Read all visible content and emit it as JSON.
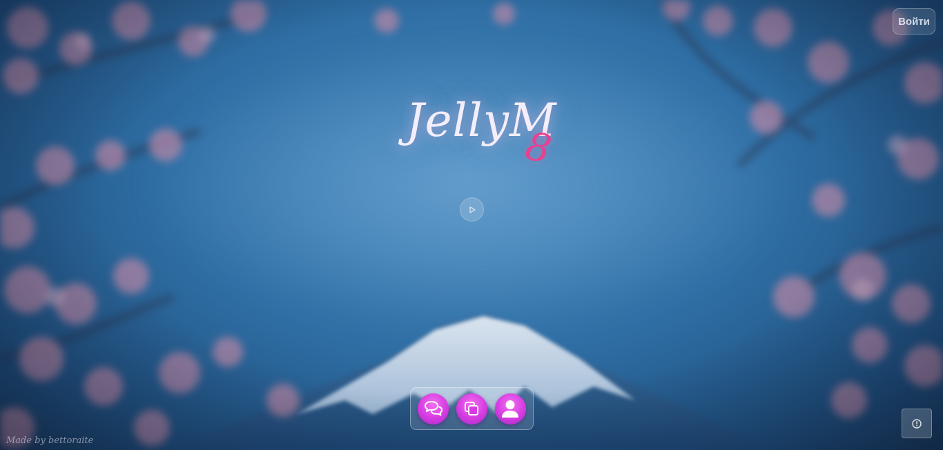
{
  "header": {
    "login_label": "Войти"
  },
  "logo": {
    "text": "JellyM",
    "suffix": "8"
  },
  "player": {
    "play_icon": "play-icon"
  },
  "dock": {
    "items": [
      {
        "icon": "chat-bubbles-icon"
      },
      {
        "icon": "copy-windows-icon"
      },
      {
        "icon": "user-icon"
      }
    ]
  },
  "footer": {
    "credit": "Made by bettoraite",
    "info_icon": "info-icon"
  },
  "colors": {
    "accent_pink": "#e9408f",
    "dock_button": "#d53be0",
    "sky": "#2f6fa5"
  }
}
